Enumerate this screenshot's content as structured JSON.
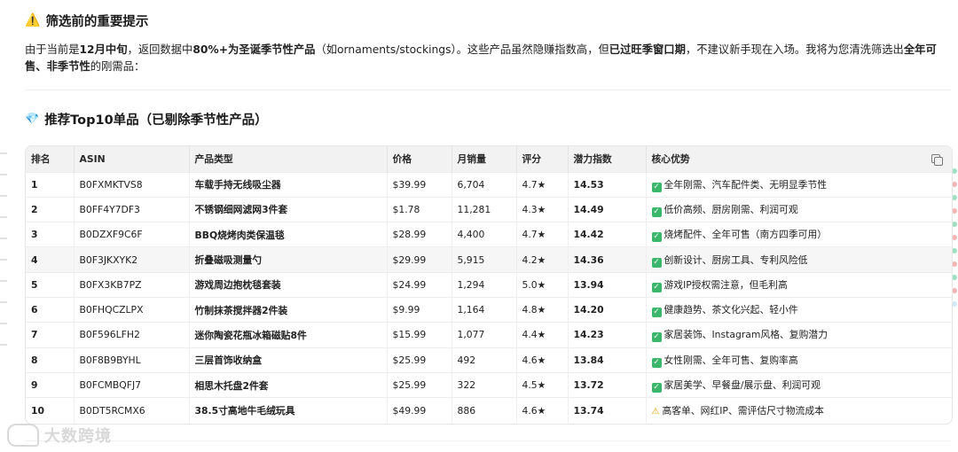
{
  "header": {
    "icon": "warning-icon",
    "title": "筛选前的重要提示"
  },
  "intro": {
    "p1": "由于当前是",
    "b1": "12月中旬",
    "p2": "，返回数据中",
    "b2": "80%+为圣诞季节性产品",
    "p3": "（如ornaments/stockings）。这些产品虽然隐赚指数高，但",
    "b3": "已过旺季窗口期",
    "p4": "，不建议新手现在入场。我将为您清洗筛选出",
    "b4": "全年可售、非季节性",
    "p5": "的刚需品："
  },
  "section": {
    "icon": "gem-icon",
    "title": "推荐Top10单品（已剔除季节性产品）"
  },
  "table": {
    "headers": [
      "排名",
      "ASIN",
      "产品类型",
      "价格",
      "月销量",
      "评分",
      "潜力指数",
      "核心优势"
    ],
    "rows": [
      {
        "rank": "1",
        "asin": "B0FXMKTVS8",
        "type": "车载手持无线吸尘器",
        "price": "$39.99",
        "sales": "6,704",
        "rating": "4.7★",
        "index": "14.53",
        "adv": "全年刚需、汽车配件类、无明显季节性",
        "mark": "check"
      },
      {
        "rank": "2",
        "asin": "B0FF4Y7DF3",
        "type": "不锈钢细网滤网3件套",
        "price": "$1.78",
        "sales": "11,281",
        "rating": "4.3★",
        "index": "14.49",
        "adv": "低价高频、厨房刚需、利润可观",
        "mark": "check"
      },
      {
        "rank": "3",
        "asin": "B0DZXF9C6F",
        "type": "BBQ烧烤肉类保温毯",
        "price": "$28.99",
        "sales": "4,400",
        "rating": "4.7★",
        "index": "14.42",
        "adv": "烧烤配件、全年可售（南方四季可用）",
        "mark": "check"
      },
      {
        "rank": "4",
        "asin": "B0F3JKXYK2",
        "type": "折叠磁吸测量勺",
        "price": "$29.99",
        "sales": "5,915",
        "rating": "4.2★",
        "index": "14.36",
        "adv": "创新设计、厨房工具、专利风险低",
        "mark": "check"
      },
      {
        "rank": "5",
        "asin": "B0FX3KB7PZ",
        "type": "游戏周边抱枕毯套装",
        "price": "$24.99",
        "sales": "1,294",
        "rating": "5.0★",
        "index": "13.94",
        "adv": "游戏IP授权需注意，但毛利高",
        "mark": "check"
      },
      {
        "rank": "6",
        "asin": "B0FHQCZLPX",
        "type": "竹制抹茶搅拌器2件装",
        "price": "$9.99",
        "sales": "1,164",
        "rating": "4.8★",
        "index": "14.20",
        "adv": "健康趋势、茶文化兴起、轻小件",
        "mark": "check"
      },
      {
        "rank": "7",
        "asin": "B0F596LFH2",
        "type": "迷你陶瓷花瓶冰箱磁贴8件",
        "price": "$15.99",
        "sales": "1,077",
        "rating": "4.4★",
        "index": "14.23",
        "adv": "家居装饰、Instagram风格、复购潜力",
        "mark": "check"
      },
      {
        "rank": "8",
        "asin": "B0F8B9BYHL",
        "type": "三层首饰收纳盒",
        "price": "$25.99",
        "sales": "492",
        "rating": "4.6★",
        "index": "13.84",
        "adv": "女性刚需、全年可售、复购率高",
        "mark": "check"
      },
      {
        "rank": "9",
        "asin": "B0FCMBQFJ7",
        "type": "相思木托盘2件套",
        "price": "$25.99",
        "sales": "322",
        "rating": "4.5★",
        "index": "13.72",
        "adv": "家居美学、早餐盘/展示盘、利润可观",
        "mark": "check"
      },
      {
        "rank": "10",
        "asin": "B0DT5RCMX6",
        "type": "38.5寸高地牛毛绒玩具",
        "price": "$49.99",
        "sales": "886",
        "rating": "4.6★",
        "index": "13.74",
        "adv": "高客单、网红IP、需评估尺寸物流成本",
        "mark": "warn"
      }
    ]
  },
  "watermark": {
    "text": "大数跨境"
  },
  "colors": {
    "check": "#3bb76b",
    "warn": "#e0a100",
    "header_bg": "#f2f2f2"
  }
}
